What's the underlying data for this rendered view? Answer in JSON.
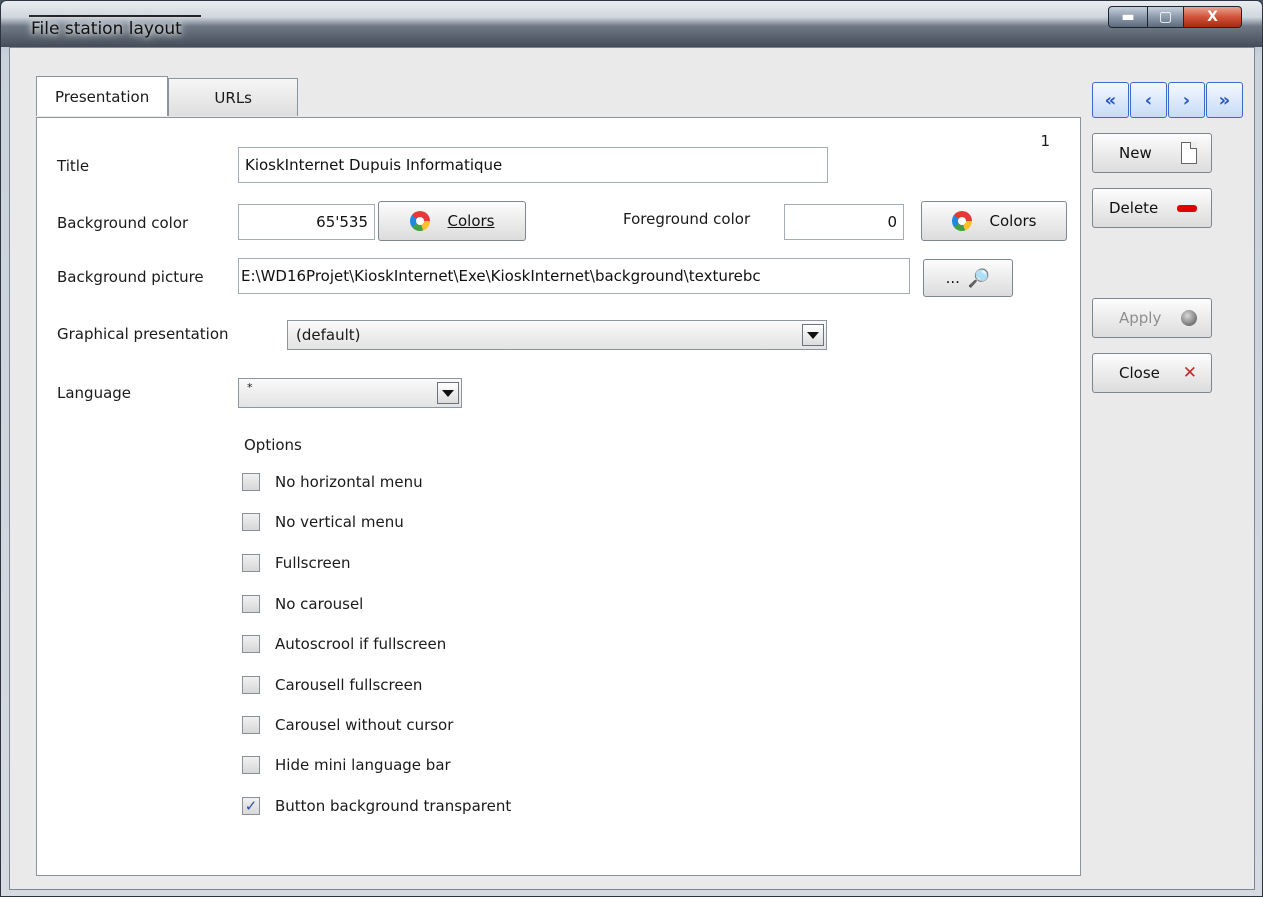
{
  "window": {
    "title": "File station layout"
  },
  "tabs": [
    {
      "label": "Presentation"
    },
    {
      "label": "URLs"
    }
  ],
  "record_index": "1",
  "form": {
    "title_label": "Title",
    "title_value": "KioskInternet Dupuis Informatique",
    "bg_color_label": "Background color",
    "bg_color_value": "65'535",
    "colors_button": "Colors",
    "fg_color_label": "Foreground color",
    "fg_color_value": "0",
    "bg_picture_label": "Background picture",
    "bg_picture_value": "E:\\WD16Projet\\KioskInternet\\Exe\\KioskInternet\\background\\texturebc",
    "browse_label": "...",
    "graphical_label": "Graphical presentation",
    "graphical_value": "(default)",
    "language_label": "Language",
    "language_value": "*",
    "options_label": "Options"
  },
  "options": [
    {
      "label": "No horizontal menu",
      "checked": false
    },
    {
      "label": "No vertical menu",
      "checked": false
    },
    {
      "label": "Fullscreen",
      "checked": false
    },
    {
      "label": "No carousel",
      "checked": false
    },
    {
      "label": "Autoscrool if fullscreen",
      "checked": false
    },
    {
      "label": "Carousell fullscreen",
      "checked": false
    },
    {
      "label": "Carousel without cursor",
      "checked": false
    },
    {
      "label": "Hide mini language bar",
      "checked": false
    },
    {
      "label": "Button background transparent",
      "checked": true
    }
  ],
  "sidebar": {
    "new_label": "New",
    "delete_label": "Delete",
    "apply_label": "Apply",
    "close_label": "Close"
  },
  "colors": {
    "accent": "#2457c5",
    "delete_red": "#e00000",
    "close_red": "#c62828"
  }
}
